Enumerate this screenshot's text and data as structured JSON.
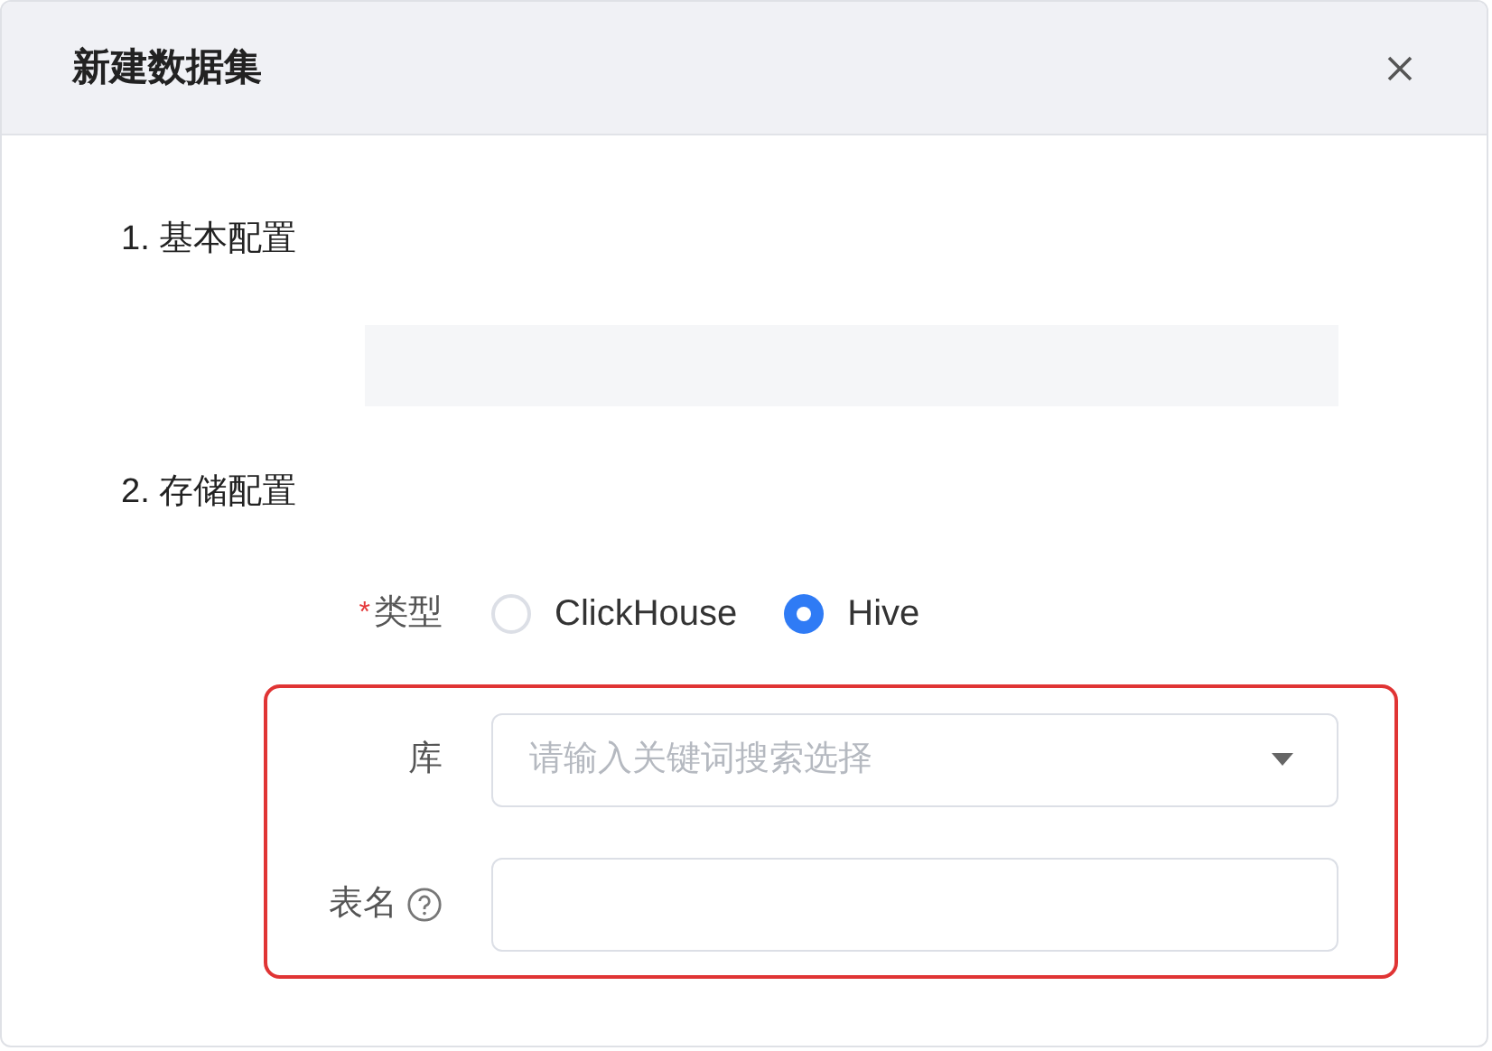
{
  "dialog": {
    "title": "新建数据集"
  },
  "basic_section": {
    "title": "1. 基本配置"
  },
  "storage_section": {
    "title": "2. 存储配置",
    "type_field": {
      "label": "类型",
      "required_mark": "*",
      "options": [
        {
          "label": "ClickHouse",
          "selected": false
        },
        {
          "label": "Hive",
          "selected": true
        }
      ]
    },
    "highlighted_fields": [
      {
        "kind": "select",
        "label": "库",
        "placeholder": "请输入关键词搜索选择"
      },
      {
        "kind": "input",
        "label": "表名",
        "help": true
      }
    ]
  }
}
